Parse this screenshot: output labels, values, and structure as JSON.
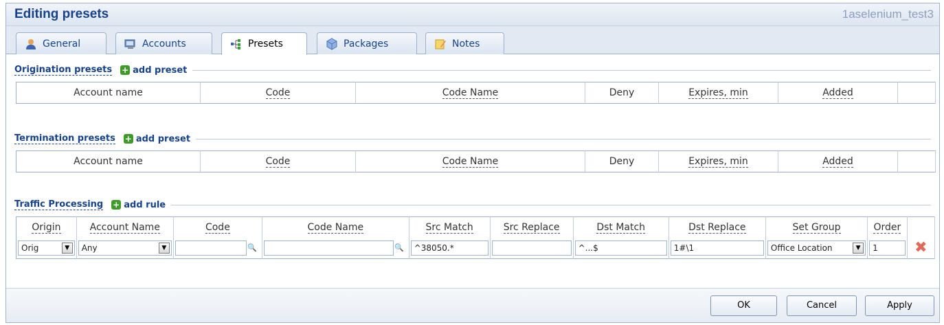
{
  "window": {
    "title": "Editing presets",
    "user": "1aselenium_test3"
  },
  "tabs": [
    {
      "label": "General"
    },
    {
      "label": "Accounts"
    },
    {
      "label": "Presets"
    },
    {
      "label": "Packages"
    },
    {
      "label": "Notes"
    }
  ],
  "origination": {
    "title": "Origination presets",
    "add_label": "add preset",
    "columns": [
      "Account name",
      "Code",
      "Code Name",
      "Deny",
      "Expires, min",
      "Added"
    ]
  },
  "termination": {
    "title": "Termination presets",
    "add_label": "add preset",
    "columns": [
      "Account name",
      "Code",
      "Code Name",
      "Deny",
      "Expires, min",
      "Added"
    ]
  },
  "traffic": {
    "title": "Traffic Processing",
    "add_label": "add rule",
    "columns": [
      "Origin",
      "Account Name",
      "Code",
      "Code Name",
      "Src Match",
      "Src Replace",
      "Dst Match",
      "Dst Replace",
      "Set Group",
      "Order"
    ],
    "row": {
      "origin": "Orig",
      "account_name": "Any",
      "code": "",
      "code_name": "",
      "src_match": "^38050.*",
      "src_replace": "",
      "dst_match": "^...$",
      "dst_replace": "1#\\1",
      "set_group": "Office Location",
      "order": "1"
    }
  },
  "buttons": {
    "ok": "OK",
    "cancel": "Cancel",
    "apply": "Apply"
  }
}
